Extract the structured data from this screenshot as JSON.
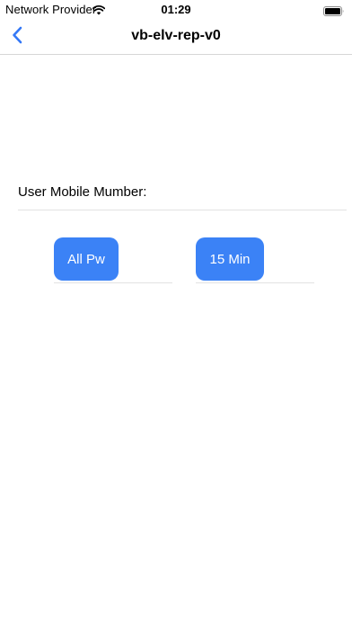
{
  "status_bar": {
    "carrier": "Network Provider",
    "time": "01:29",
    "wifi_icon": "wifi-icon",
    "battery_icon": "battery-full-icon"
  },
  "nav": {
    "back_icon": "chevron-left-icon",
    "title": "vb-elv-rep-v0"
  },
  "form": {
    "mobile_label": "User Mobile Mumber:"
  },
  "buttons": {
    "all_pw": "All Pw",
    "fifteen_min": "15 Min"
  },
  "colors": {
    "accent": "#3b82f6",
    "back_chevron": "#3478f6"
  }
}
